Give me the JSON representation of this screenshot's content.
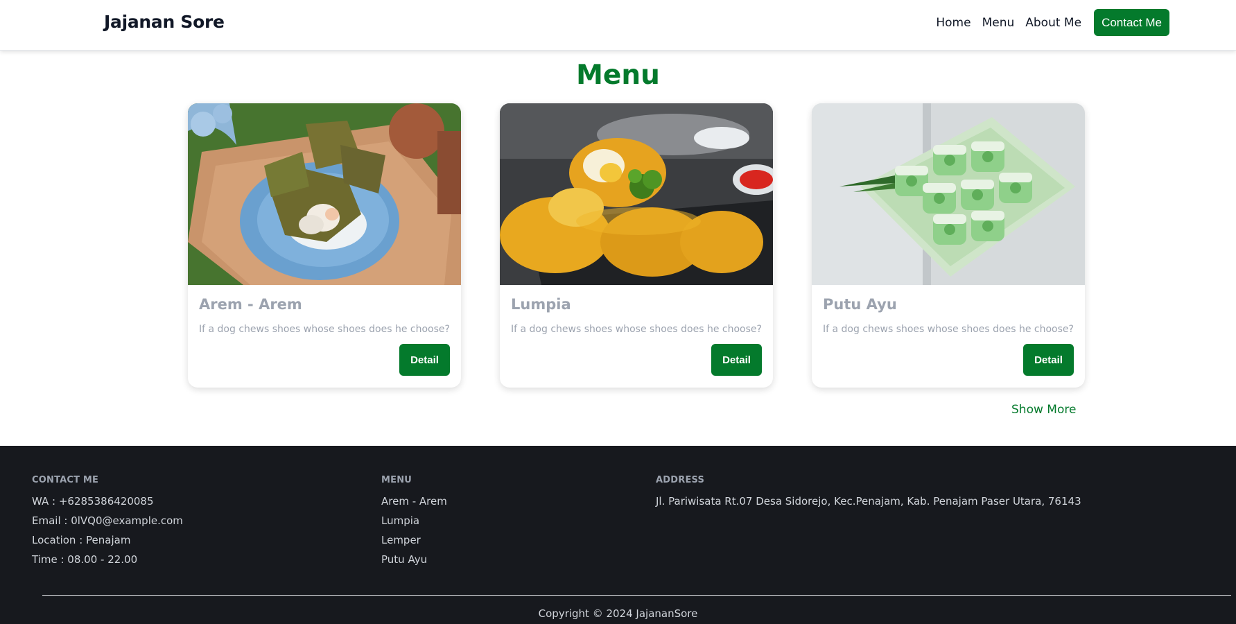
{
  "nav": {
    "brand": "Jajanan Sore",
    "links": [
      {
        "label": "Home"
      },
      {
        "label": "Menu"
      },
      {
        "label": "About Me"
      }
    ],
    "cta_label": "Contact Me"
  },
  "menu": {
    "title": "Menu",
    "cards": [
      {
        "title": "Arem - Arem",
        "description": "If a dog chews shoes whose shoes does he choose?",
        "button": "Detail"
      },
      {
        "title": "Lumpia",
        "description": "If a dog chews shoes whose shoes does he choose?",
        "button": "Detail"
      },
      {
        "title": "Putu Ayu",
        "description": "If a dog chews shoes whose shoes does he choose?",
        "button": "Detail"
      }
    ],
    "show_more": "Show More"
  },
  "footer": {
    "contact": {
      "heading": "CONTACT ME",
      "items": [
        "WA : +6285386420085",
        "Email : 0lVQ0@example.com",
        "Location : Penajam",
        "Time : 08.00 - 22.00"
      ]
    },
    "menu": {
      "heading": "MENU",
      "items": [
        "Arem - Arem",
        "Lumpia",
        "Lemper",
        "Putu Ayu"
      ]
    },
    "address": {
      "heading": "ADDRESS",
      "text": "Jl. Pariwisata Rt.07 Desa Sidorejo, Kec.Penajam, Kab. Penajam Paser Utara, 76143"
    },
    "copyright": "Copyright © 2024 JajananSore"
  },
  "colors": {
    "primary": "#047a2c",
    "footer_bg": "#17191e",
    "muted_text": "#9ca3af"
  }
}
